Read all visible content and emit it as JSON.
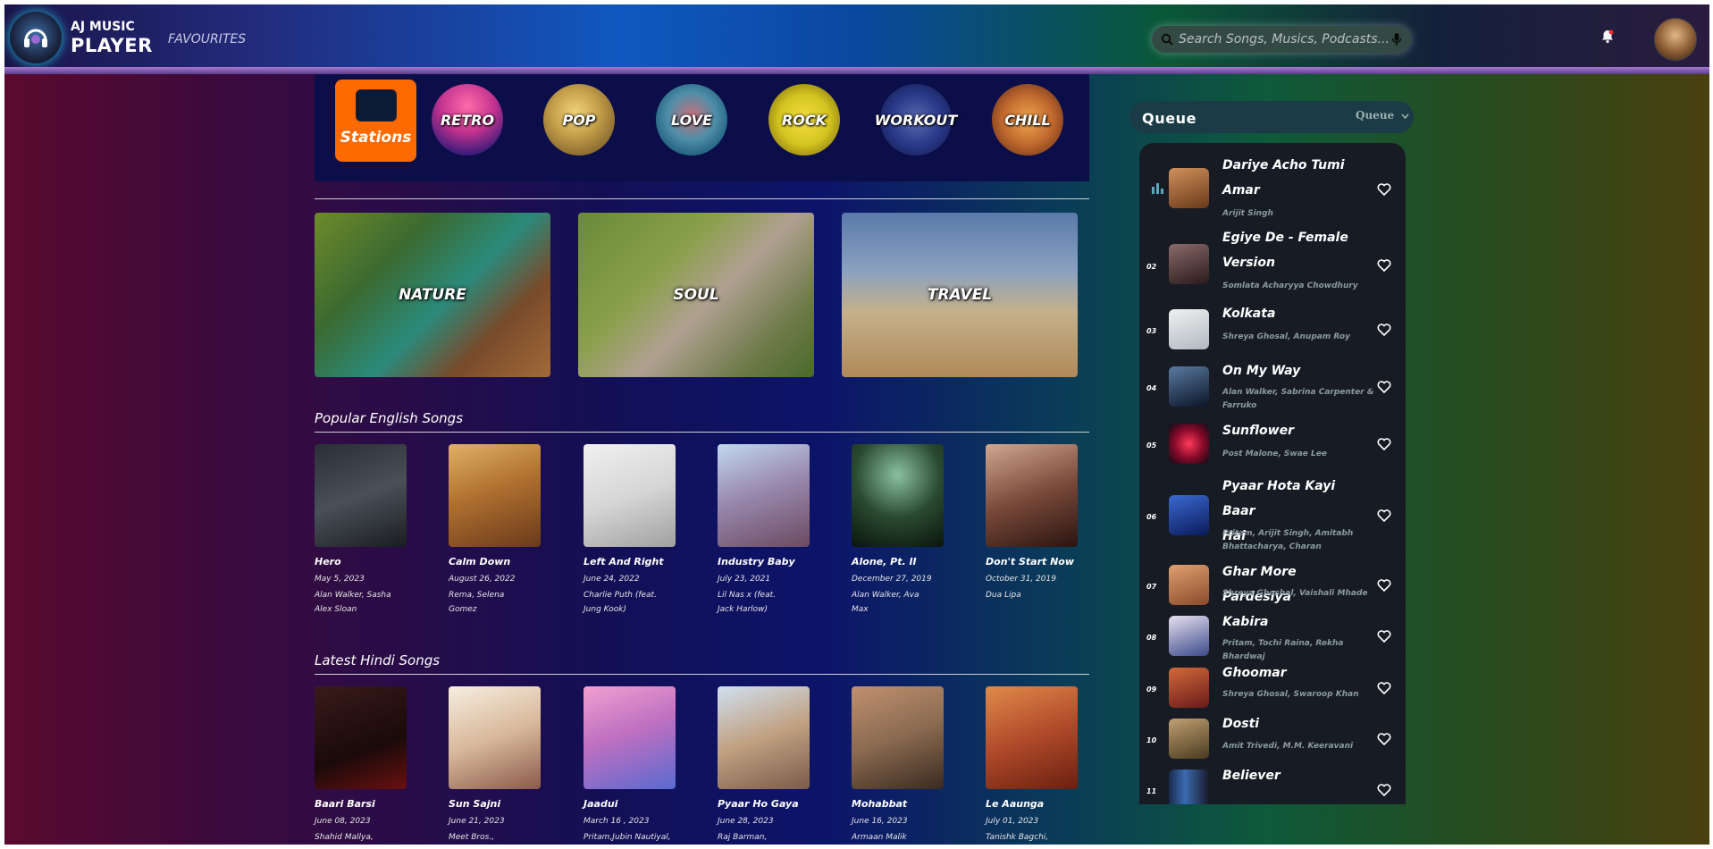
{
  "header": {
    "logo_line1": "AJ MUSIC",
    "logo_line2": "PLAYER",
    "nav_favourites": "FAVOURITES",
    "search_placeholder": "Search Songs, Musics, Podcasts...",
    "accent": "#ff6a00"
  },
  "stations": {
    "button_label": "Stations",
    "genres": [
      "RETRO",
      "POP",
      "LOVE",
      "ROCK",
      "WORKOUT",
      "CHILL"
    ]
  },
  "moods": [
    "NATURE",
    "SOUL",
    "TRAVEL"
  ],
  "popular_english": {
    "title": "Popular English Songs",
    "songs": [
      {
        "title": "Hero",
        "date": "May 5, 2023",
        "artist_l1": "Alan Walker, Sasha",
        "artist_l2": "Alex Sloan"
      },
      {
        "title": "Calm Down",
        "date": "August 26, 2022",
        "artist_l1": "Rema, Selena",
        "artist_l2": "Gomez"
      },
      {
        "title": "Left And Right",
        "date": "June 24, 2022",
        "artist_l1": "Charlie Puth (feat.",
        "artist_l2": "Jung Kook)"
      },
      {
        "title": "Industry Baby",
        "date": "July 23, 2021",
        "artist_l1": "Lil Nas x (feat.",
        "artist_l2": "Jack Harlow)"
      },
      {
        "title": "Alone, Pt. II",
        "date": "December 27, 2019",
        "artist_l1": "Alan Walker, Ava",
        "artist_l2": "Max"
      },
      {
        "title": "Don't Start Now",
        "date": "October 31, 2019",
        "artist_l1": "Dua Lipa",
        "artist_l2": ""
      }
    ]
  },
  "latest_hindi": {
    "title": "Latest Hindi Songs",
    "songs": [
      {
        "title": "Baari Barsi",
        "date": "June 08, 2023",
        "artist_l1": "Shahid Mallya,"
      },
      {
        "title": "Sun Sajni",
        "date": "June 21, 2023",
        "artist_l1": "Meet Bros.,"
      },
      {
        "title": "Jaadui",
        "date": "March 16 , 2023",
        "artist_l1": "Pritam,Jubin Nautiyal,"
      },
      {
        "title": "Pyaar Ho Gaya",
        "date": "June 28, 2023",
        "artist_l1": "Raj Barman,"
      },
      {
        "title": "Mohabbat",
        "date": "June 16, 2023",
        "artist_l1": "Armaan Malik"
      },
      {
        "title": "Le Aaunga",
        "date": "July 01, 2023",
        "artist_l1": "Tanishk Bagchi,"
      }
    ]
  },
  "queue": {
    "title": "Queue",
    "select_value": "Queue",
    "items": [
      {
        "num": "",
        "title_l1": "Dariye Acho Tumi",
        "title_l2": "Amar",
        "artist_l1": "Arijit Singh",
        "artist_l2": ""
      },
      {
        "num": "02",
        "title_l1": "Egiye De - Female",
        "title_l2": "Version",
        "artist_l1": "Somlata Acharyya Chowdhury",
        "artist_l2": ""
      },
      {
        "num": "03",
        "title_l1": "Kolkata",
        "title_l2": "",
        "artist_l1": "Shreya Ghosal, Anupam Roy",
        "artist_l2": ""
      },
      {
        "num": "04",
        "title_l1": "On My Way",
        "title_l2": "",
        "artist_l1": "Alan Walker, Sabrina Carpenter &",
        "artist_l2": "Farruko"
      },
      {
        "num": "05",
        "title_l1": "Sunflower",
        "title_l2": "",
        "artist_l1": "Post Malone, Swae Lee",
        "artist_l2": ""
      },
      {
        "num": "06",
        "title_l1": "Pyaar Hota Kayi Baar",
        "title_l2": "Hai",
        "artist_l1": "Pritam, Arijit Singh, Amitabh",
        "artist_l2": "Bhattacharya, Charan"
      },
      {
        "num": "07",
        "title_l1": "Ghar More Pardesiya",
        "title_l2": "",
        "artist_l1": "Shreya Ghoshal, Vaishali Mhade",
        "artist_l2": ""
      },
      {
        "num": "08",
        "title_l1": "Kabira",
        "title_l2": "",
        "artist_l1": "Pritam, Tochi Raina, Rekha Bhardwaj",
        "artist_l2": ""
      },
      {
        "num": "09",
        "title_l1": "Ghoomar",
        "title_l2": "",
        "artist_l1": "Shreya Ghosal, Swaroop Khan",
        "artist_l2": ""
      },
      {
        "num": "10",
        "title_l1": "Dosti",
        "title_l2": "",
        "artist_l1": "Amit Trivedi, M.M. Keeravani",
        "artist_l2": ""
      },
      {
        "num": "11",
        "title_l1": "Believer",
        "title_l2": "",
        "artist_l1": "",
        "artist_l2": ""
      }
    ]
  }
}
